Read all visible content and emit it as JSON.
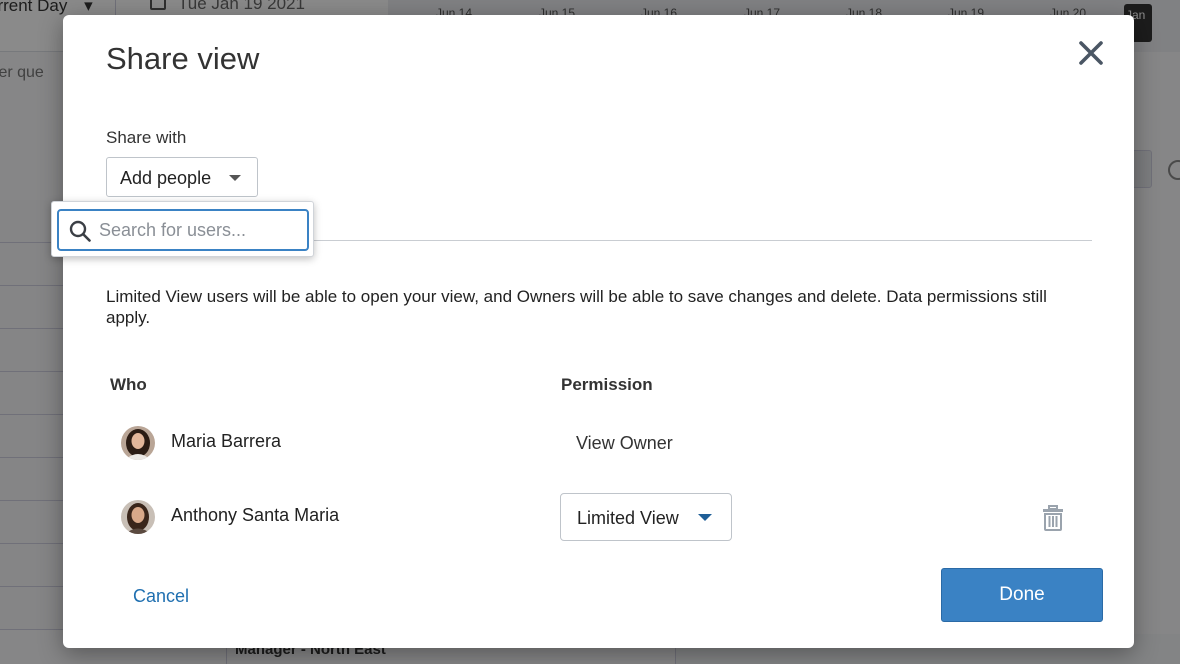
{
  "background": {
    "day_selector": "urrent Day",
    "date": "Tue Jan 19 2021",
    "day_columns": [
      "Jun 14",
      "Jun 15",
      "Jun 16",
      "Jun 17",
      "Jun 18",
      "Jun 19",
      "Jun 20"
    ],
    "today_marker": "Jan",
    "filter_placeholder": "ter que",
    "row_label": "Manager - North East"
  },
  "modal": {
    "title": "Share view",
    "close_icon": "close-icon",
    "share_with_label": "Share with",
    "add_people_label": "Add people",
    "search": {
      "placeholder": "Search for users...",
      "value": ""
    },
    "info_text": "Limited View users will be able to open your view, and Owners will be able to save changes and delete. Data permissions still apply.",
    "columns": {
      "who": "Who",
      "permission": "Permission"
    },
    "users": [
      {
        "name": "Maria Barrera",
        "permission": "View Owner"
      },
      {
        "name": "Anthony Santa Maria",
        "permission": "Limited View",
        "permission_editable": true
      }
    ],
    "cancel_label": "Cancel",
    "done_label": "Done"
  },
  "colors": {
    "accent": "#3a82c4",
    "link": "#1f6fb0",
    "overlay": "rgba(0,0,0,0.45)"
  }
}
